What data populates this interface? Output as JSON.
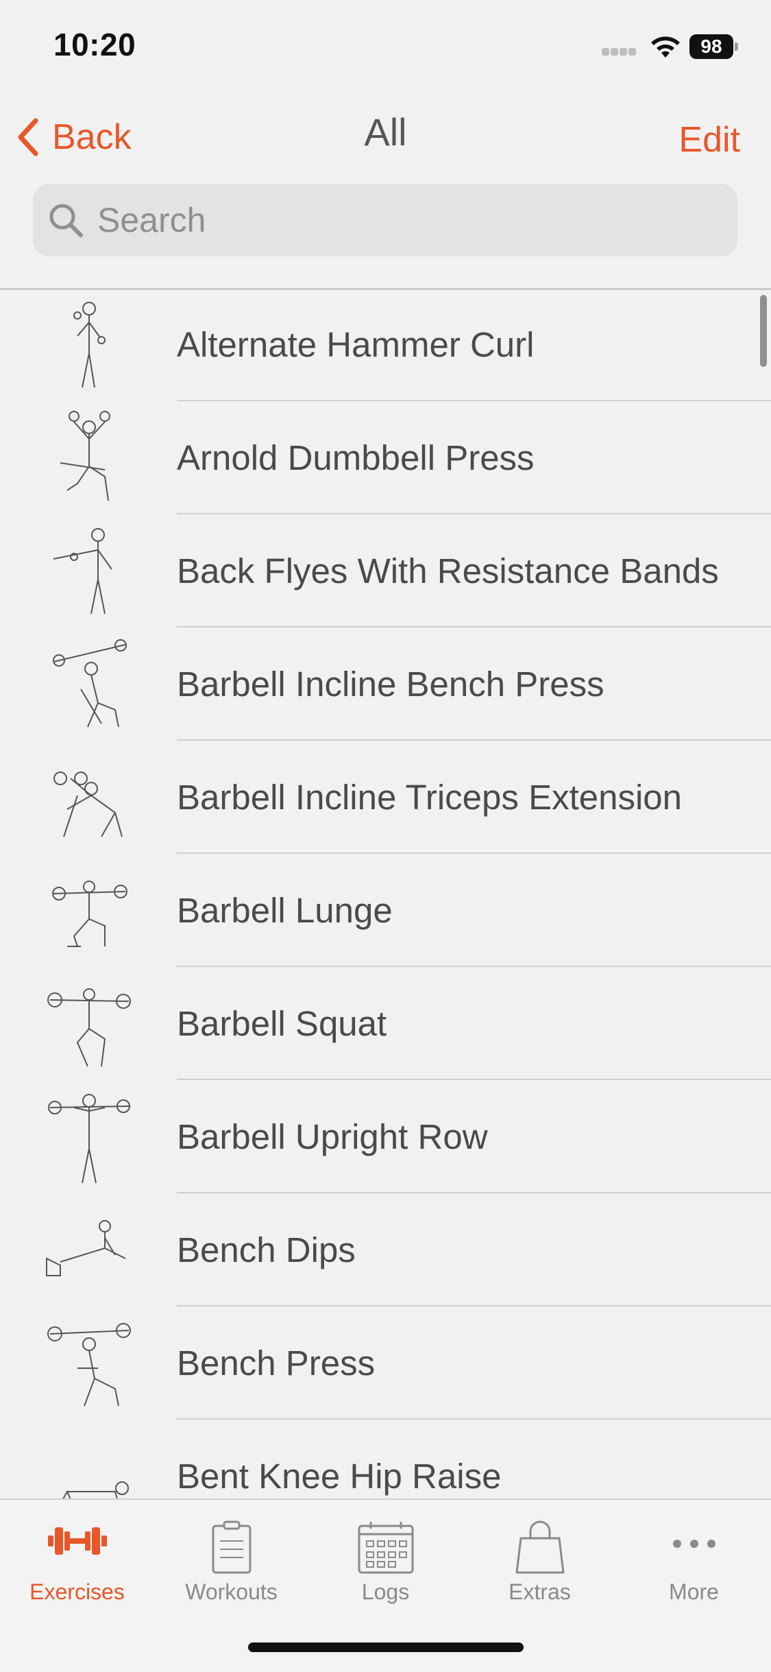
{
  "status": {
    "time": "10:20",
    "battery": "98"
  },
  "nav": {
    "back_label": "Back",
    "title": "All",
    "edit_label": "Edit"
  },
  "search": {
    "placeholder": "Search"
  },
  "exercises": [
    {
      "name": "Alternate Hammer Curl"
    },
    {
      "name": "Arnold Dumbbell Press"
    },
    {
      "name": "Back Flyes With Resistance Bands"
    },
    {
      "name": "Barbell Incline Bench Press"
    },
    {
      "name": "Barbell Incline Triceps Extension"
    },
    {
      "name": "Barbell Lunge"
    },
    {
      "name": "Barbell Squat"
    },
    {
      "name": "Barbell Upright Row"
    },
    {
      "name": "Bench Dips"
    },
    {
      "name": "Bench Press"
    },
    {
      "name": "Bent Knee Hip Raise"
    }
  ],
  "tabs": [
    {
      "label": "Exercises",
      "icon": "dumbbell-icon",
      "active": true
    },
    {
      "label": "Workouts",
      "icon": "clipboard-icon",
      "active": false
    },
    {
      "label": "Logs",
      "icon": "calendar-icon",
      "active": false
    },
    {
      "label": "Extras",
      "icon": "shopping-bag-icon",
      "active": false
    },
    {
      "label": "More",
      "icon": "more-dots-icon",
      "active": false
    }
  ],
  "colors": {
    "accent": "#e8572a",
    "inactive": "#8a8a8a",
    "background": "#f1f1f1"
  }
}
